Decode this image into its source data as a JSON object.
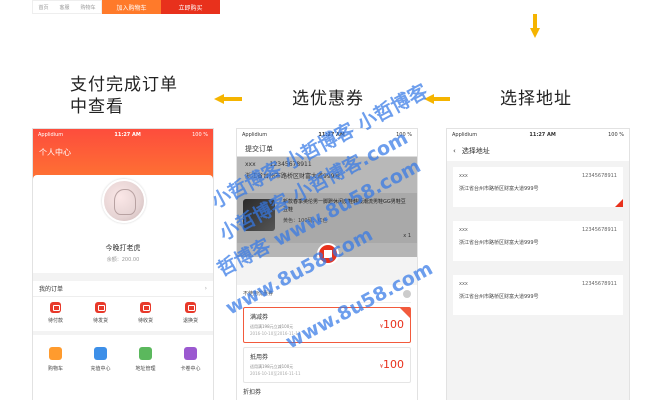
{
  "top_strip": {
    "mini_labels": [
      "首页",
      "客服",
      "购物车"
    ],
    "add_to_cart": "加入购物车",
    "buy_now": "立即购买"
  },
  "captions": {
    "pay_done": "支付完成订单中查看",
    "choose_coupon": "选优惠券",
    "choose_address": "选择地址"
  },
  "status_bar": {
    "carrier": "Applidium",
    "time": "11:27 AM",
    "battery": "100 %"
  },
  "phone1": {
    "title": "个人中心",
    "username": "今晚打老虎",
    "balance": "余额：200.00",
    "orders_title": "我的订单",
    "order_items": [
      "待付款",
      "待发货",
      "待收货",
      "退换货"
    ],
    "grid_items": [
      {
        "label": "购物车",
        "color": "#ff9b2e"
      },
      {
        "label": "充值中心",
        "color": "#3d8fe8"
      },
      {
        "label": "地址管理",
        "color": "#5bb85d"
      },
      {
        "label": "卡卷中心",
        "color": "#9b59d0"
      }
    ]
  },
  "phone2": {
    "title": "提交订单",
    "addr_name": "xxx",
    "addr_phone": "12345678911",
    "addr_street": "浙江省台州市路桥区财富大道999号",
    "product_desc": "新款春季英伦男一脚蹬休闲皮鞋韩版潮流男鞋GG男鞋豆豆鞋",
    "product_color": "黄色：100码；红色",
    "product_qty": "x 1",
    "no_coupon": "不使用优惠券",
    "coupons": [
      {
        "name": "满减券",
        "rule": "适用满198元立减100元",
        "date": "2016-10-10至2016-11-11",
        "amount": "100"
      },
      {
        "name": "抵用券",
        "rule": "适用满198元立减100元",
        "date": "2016-10-10至2016-11-11",
        "amount": "100"
      }
    ],
    "third_label": "折扣券"
  },
  "phone3": {
    "title": "选择地址",
    "addresses": [
      {
        "name": "xxx",
        "phone": "12345678911",
        "street": "浙江省台州市路桥区财富大道999号"
      },
      {
        "name": "xxx",
        "phone": "12345678911",
        "street": "浙江省台州市路桥区财富大道999号"
      },
      {
        "name": "xxx",
        "phone": "12345678911",
        "street": "浙江省台州市路桥区财富大道999号"
      }
    ]
  },
  "watermark": {
    "line1": "小哲博客 小哲博客 小哲博客",
    "line2": "小哲博客 小哲博客.com",
    "line3": "哲博客 www.8u58.com",
    "line4": "www.8u58.com",
    "line5": "www.8u58.com"
  }
}
